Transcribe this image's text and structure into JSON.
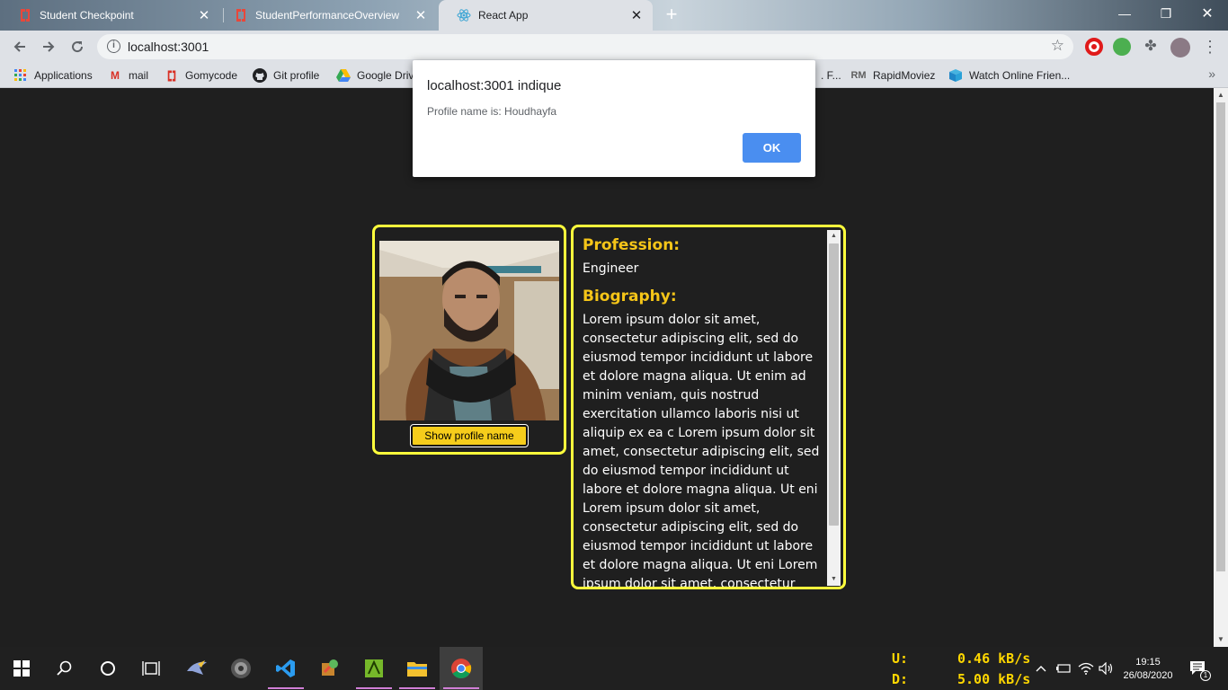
{
  "browser": {
    "tabs": [
      {
        "title": "Student Checkpoint",
        "active": false
      },
      {
        "title": "StudentPerformanceOverview",
        "active": false
      },
      {
        "title": "React App",
        "active": true
      }
    ],
    "url": "localhost:3001",
    "bookmarks": [
      {
        "label": "Applications",
        "icon": "apps-grid-icon"
      },
      {
        "label": "mail",
        "icon": "gmail-icon"
      },
      {
        "label": "Gomycode",
        "icon": "gomycode-icon"
      },
      {
        "label": "Git profile",
        "icon": "github-icon"
      },
      {
        "label": "Google Driv",
        "icon": "google-drive-icon"
      },
      {
        "label": ". F...",
        "icon": ""
      },
      {
        "label": "RapidMoviez",
        "icon": "rapidmoviez-icon"
      },
      {
        "label": "Watch Online Frien...",
        "icon": "box-icon"
      }
    ]
  },
  "dialog": {
    "title": "localhost:3001 indique",
    "message": "Profile name is: Houdhayfa",
    "ok_label": "OK"
  },
  "profile": {
    "button_label": "Show profile name",
    "profession_heading": "Profession:",
    "profession": "Engineer",
    "biography_heading": "Biography:",
    "biography": "Lorem ipsum dolor sit amet, consectetur adipiscing elit, sed do eiusmod tempor incididunt ut labore et dolore magna aliqua. Ut enim ad minim veniam, quis nostrud exercitation ullamco laboris nisi ut aliquip ex ea c Lorem ipsum dolor sit amet, consectetur adipiscing elit, sed do eiusmod tempor incididunt ut labore et dolore magna aliqua. Ut eni Lorem ipsum dolor sit amet, consectetur adipiscing elit, sed do eiusmod tempor incididunt ut labore et dolore magna aliqua. Ut eni Lorem ipsum dolor sit amet, consectetur"
  },
  "taskbar": {
    "net_upload_label": "U:",
    "net_upload_value": "0.46 kB/s",
    "net_download_label": "D:",
    "net_download_value": "5.00 kB/s",
    "time": "19:15",
    "date": "26/08/2020",
    "notification_count": "1"
  },
  "colors": {
    "accent_border": "#ffff3c",
    "heading": "#f5c518",
    "button": "#f6cd1b",
    "ok_button": "#4a8ef0"
  }
}
